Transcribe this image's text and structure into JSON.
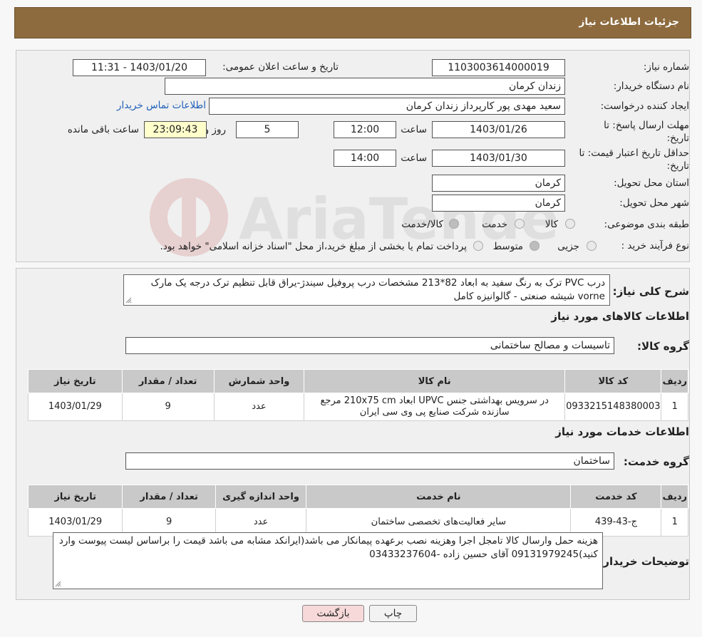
{
  "header": {
    "title": "جزئیات اطلاعات نیاز"
  },
  "form": {
    "need_number_label": "شماره نیاز:",
    "need_number": "1103003614000019",
    "announce_label": "تاریخ و ساعت اعلان عمومی:",
    "announce_value": "1403/01/20 - 11:31",
    "buyer_org_label": "نام دستگاه خریدار:",
    "buyer_org": "زندان کرمان",
    "creator_label": "ایجاد کننده درخواست:",
    "creator": "سعید مهدی پور کارپرداز زندان کرمان",
    "contact_link": "اطلاعات تماس خریدار",
    "deadline_label": "مهلت ارسال پاسخ: تا تاریخ:",
    "deadline_date": "1403/01/26",
    "time_word": "ساعت",
    "deadline_time": "12:00",
    "days": "5",
    "days_word": "روز و",
    "remaining_time": "23:09:43",
    "remaining_label": "ساعت باقی مانده",
    "validity_label": "حداقل تاریخ اعتبار قیمت: تا تاریخ:",
    "validity_date": "1403/01/30",
    "validity_time": "14:00",
    "province_label": "استان محل تحویل:",
    "province": "کرمان",
    "city_label": "شهر محل تحویل:",
    "city": "کرمان",
    "category_label": "طبقه بندی موضوعی:",
    "category_options": [
      "کالا",
      "خدمت",
      "کالا/خدمت"
    ],
    "process_label": "نوع فرآیند خرید :",
    "process_options": [
      "جزیی",
      "متوسط"
    ],
    "process_note": "پرداخت تمام یا بخشی از مبلغ خرید،از محل \"اسناد خزانه اسلامی\" خواهد بود."
  },
  "summary": {
    "label": "شرح کلی نیاز:",
    "text": "درب PVC ترک به رنگ سفید به ابعاد 82*213 مشخصات درب پروفیل سیندژ-یراق قابل تنظیم ترک درجه یک مارک vorne شیشه صنعتی - گالوانیزه کامل"
  },
  "goods": {
    "section_title": "اطلاعات کالاهای مورد نیاز",
    "group_label": "گروه کالا:",
    "group_value": "تاسیسات و مصالح ساختمانی",
    "headers": [
      "ردیف",
      "کد کالا",
      "نام کالا",
      "واحد شمارش",
      "تعداد / مقدار",
      "تاریخ نیاز"
    ],
    "rows": [
      {
        "row": "1",
        "code": "0933215148380003",
        "name_line1": "در سرویس بهداشتی جنس UPVC ابعاد 210x75 cm مرجع",
        "name_line2": "سازنده شرکت صنایع پی وی سی ایران",
        "unit": "عدد",
        "qty": "9",
        "date": "1403/01/29"
      }
    ]
  },
  "services": {
    "section_title": "اطلاعات خدمات مورد نیاز",
    "group_label": "گروه خدمت:",
    "group_value": "ساختمان",
    "headers": [
      "ردیف",
      "کد خدمت",
      "نام خدمت",
      "واحد اندازه گیری",
      "تعداد / مقدار",
      "تاریخ نیاز"
    ],
    "rows": [
      {
        "row": "1",
        "code": "ج-43-439",
        "name": "سایر فعالیت‌های تخصصی ساختمان",
        "unit": "عدد",
        "qty": "9",
        "date": "1403/01/29"
      }
    ]
  },
  "notes": {
    "label": "توضیحات خریدار:",
    "text": "هزینه حمل وارسال کالا تامجل اجرا وهزینه نصب برعهده پیمانکار می باشد(ایرانکد مشابه می باشد قیمت را براساس لیست پیوست وارد کنید)09131979245 آقای حسین زاده -03433237604"
  },
  "buttons": {
    "print": "چاپ",
    "back": "بازگشت"
  },
  "watermark": {
    "text": "AriaTender.neT"
  },
  "colors": {
    "header_bg": "#8d6b3e",
    "link": "#1f5fb8",
    "back_button_bg": "#f7d9d9",
    "yellow_box": "#ffffcc"
  }
}
